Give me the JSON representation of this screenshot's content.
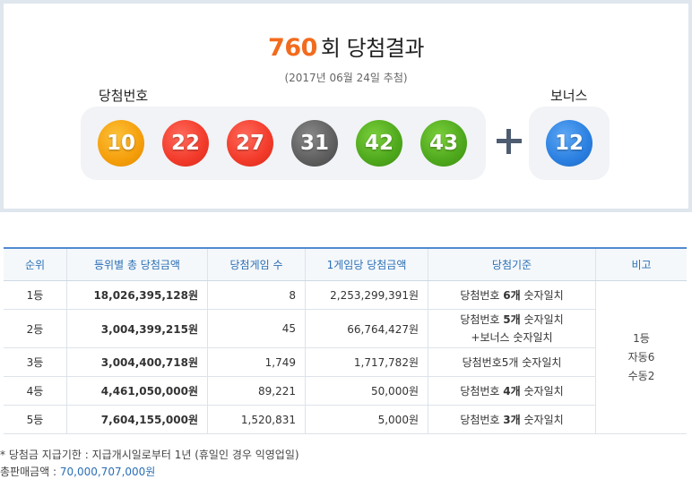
{
  "header": {
    "round_number": "760",
    "round_suffix": "회 당첨결과",
    "draw_date": "(2017년 06월 24일 추첨)",
    "winning_label": "당첨번호",
    "bonus_label": "보너스"
  },
  "winning_numbers": [
    "10",
    "22",
    "27",
    "31",
    "42",
    "43"
  ],
  "bonus_number": "12",
  "colors": {
    "accent_orange": "#f26b1d",
    "header_blue": "#2a6fb5",
    "ball_yellow": "#f59e0b",
    "ball_red": "#f23a2a",
    "ball_gray": "#5e5e5e",
    "ball_green": "#4ea81c",
    "ball_blue": "#2a7fe0"
  },
  "table": {
    "headers": [
      "순위",
      "등위별 총 당첨금액",
      "당첨게임 수",
      "1게임당 당첨금액",
      "당첨기준",
      "비고"
    ],
    "rows": [
      {
        "rank": "1등",
        "total": "18,026,395,128원",
        "games": "8",
        "per_game": "2,253,299,391원",
        "criteria_prefix": "당첨번호 ",
        "criteria_bold": "6개",
        "criteria_suffix": " 숫자일치",
        "criteria_line2": ""
      },
      {
        "rank": "2등",
        "total": "3,004,399,215원",
        "games": "45",
        "per_game": "66,764,427원",
        "criteria_prefix": "당첨번호 ",
        "criteria_bold": "5개",
        "criteria_suffix": " 숫자일치",
        "criteria_line2": "+보너스 숫자일치"
      },
      {
        "rank": "3등",
        "total": "3,004,400,718원",
        "games": "1,749",
        "per_game": "1,717,782원",
        "criteria_prefix": "당첨번호",
        "criteria_bold": "5개",
        "criteria_suffix": " 숫자일치",
        "criteria_line2": ""
      },
      {
        "rank": "4등",
        "total": "4,461,050,000원",
        "games": "89,221",
        "per_game": "50,000원",
        "criteria_prefix": "당첨번호 ",
        "criteria_bold": "4개",
        "criteria_suffix": " 숫자일치",
        "criteria_line2": ""
      },
      {
        "rank": "5등",
        "total": "7,604,155,000원",
        "games": "1,520,831",
        "per_game": "5,000원",
        "criteria_prefix": "당첨번호 ",
        "criteria_bold": "3개",
        "criteria_suffix": " 숫자일치",
        "criteria_line2": ""
      }
    ],
    "note_lines": [
      "1등",
      "자동6",
      "수동2"
    ]
  },
  "footer": {
    "payout_notice": "* 당첨금 지급기한 : 지급개시일로부터 1년 (휴일인 경우 익영업일)",
    "sales_label": "총판매금액 : ",
    "sales_value": "70,000,707,000원"
  }
}
